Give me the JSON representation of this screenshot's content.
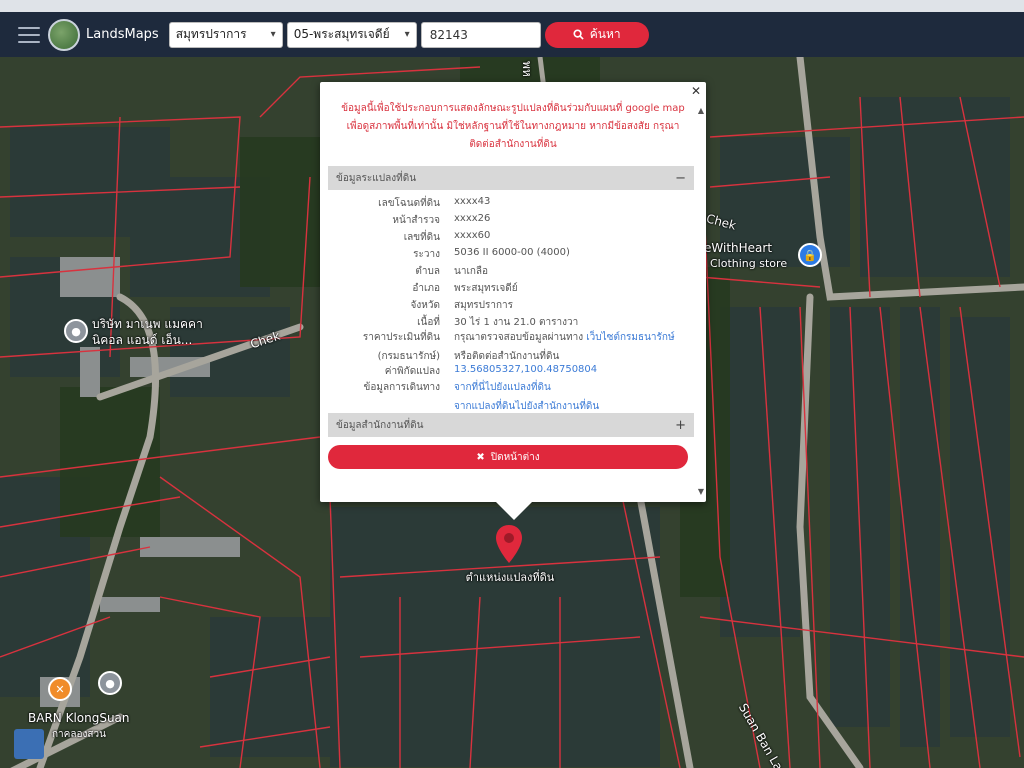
{
  "navbar": {
    "brand": "LandsMaps",
    "province": "สมุทรปราการ",
    "district": "05-พระสมุทรเจดีย์",
    "parcel_no": "82143",
    "search_label": "ค้นหา"
  },
  "map_labels": {
    "road_top": "พห",
    "store_name": "eWithHeart",
    "store_type": "Clothing store",
    "company_1": "บริษัท มาเนพ แมคคา",
    "company_2": "นิคอล แอนด์ เอ็น...",
    "chek_1": "Chek",
    "chek_2": "Chek",
    "barn": "BARN KlongSuan",
    "barn_sub": "กาคลองสวน",
    "suan_ban": "Suan Ban Lang",
    "pin_label": "ตำแหน่งแปลงที่ดิน"
  },
  "popup": {
    "disclaimer_1": "ข้อมูลนี้เพื่อใช้ประกอบการแสดงลักษณะรูปแปลงที่ดินร่วมกับแผนที่ google map",
    "disclaimer_2": "เพื่อดูสภาพพื้นที่เท่านั้น มิใช่หลักฐานที่ใช้ในทางกฎหมาย หากมีข้อสงสัย กรุณา",
    "disclaimer_3": "ติดต่อสำนักงานที่ดิน",
    "section_parcel": "ข้อมูลระแปลงที่ดิน",
    "section_office": "ข้อมูลสำนักงานที่ดิน",
    "rows": [
      {
        "k": "เลขโฉนดที่ดิน",
        "v": "xxxx43"
      },
      {
        "k": "หน้าสำรวจ",
        "v": "xxxx26"
      },
      {
        "k": "เลขที่ดิน",
        "v": "xxxx60"
      },
      {
        "k": "ระวาง",
        "v": "5036 II 6000-00 (4000)"
      },
      {
        "k": "ตำบล",
        "v": "นาเกลือ"
      },
      {
        "k": "อำเภอ",
        "v": "พระสมุทรเจดีย์"
      },
      {
        "k": "จังหวัด",
        "v": "สมุทรปราการ"
      },
      {
        "k": "เนื้อที่",
        "v": "30 ไร่ 1 งาน 21.0 ตารางวา"
      }
    ],
    "price_key_1": "ราคาประเมินที่ดิน",
    "price_key_2": "(กรมธนารักษ์)",
    "price_val_1": "กรุณาตรวจสอบข้อมูลผ่านทาง ",
    "price_link": "เว็บไซต์กรมธนารักษ์",
    "price_val_2": "หรือติดต่อสำนักงานที่ดิน",
    "coord_key": "ค่าพิกัดแปลง",
    "coord_val": "13.56805327,100.48750804",
    "travel_key": "ข้อมูลการเดินทาง",
    "travel_1": "จากที่นี่ไปยังแปลงที่ดิน",
    "travel_2": "จากแปลงที่ดินไปยังสำนักงานที่ดิน",
    "close_label": "ปิดหน้าต่าง"
  },
  "colors": {
    "accent": "#e0283c",
    "navbar": "#1e2a3d",
    "parcel_line": "#d8323e"
  }
}
